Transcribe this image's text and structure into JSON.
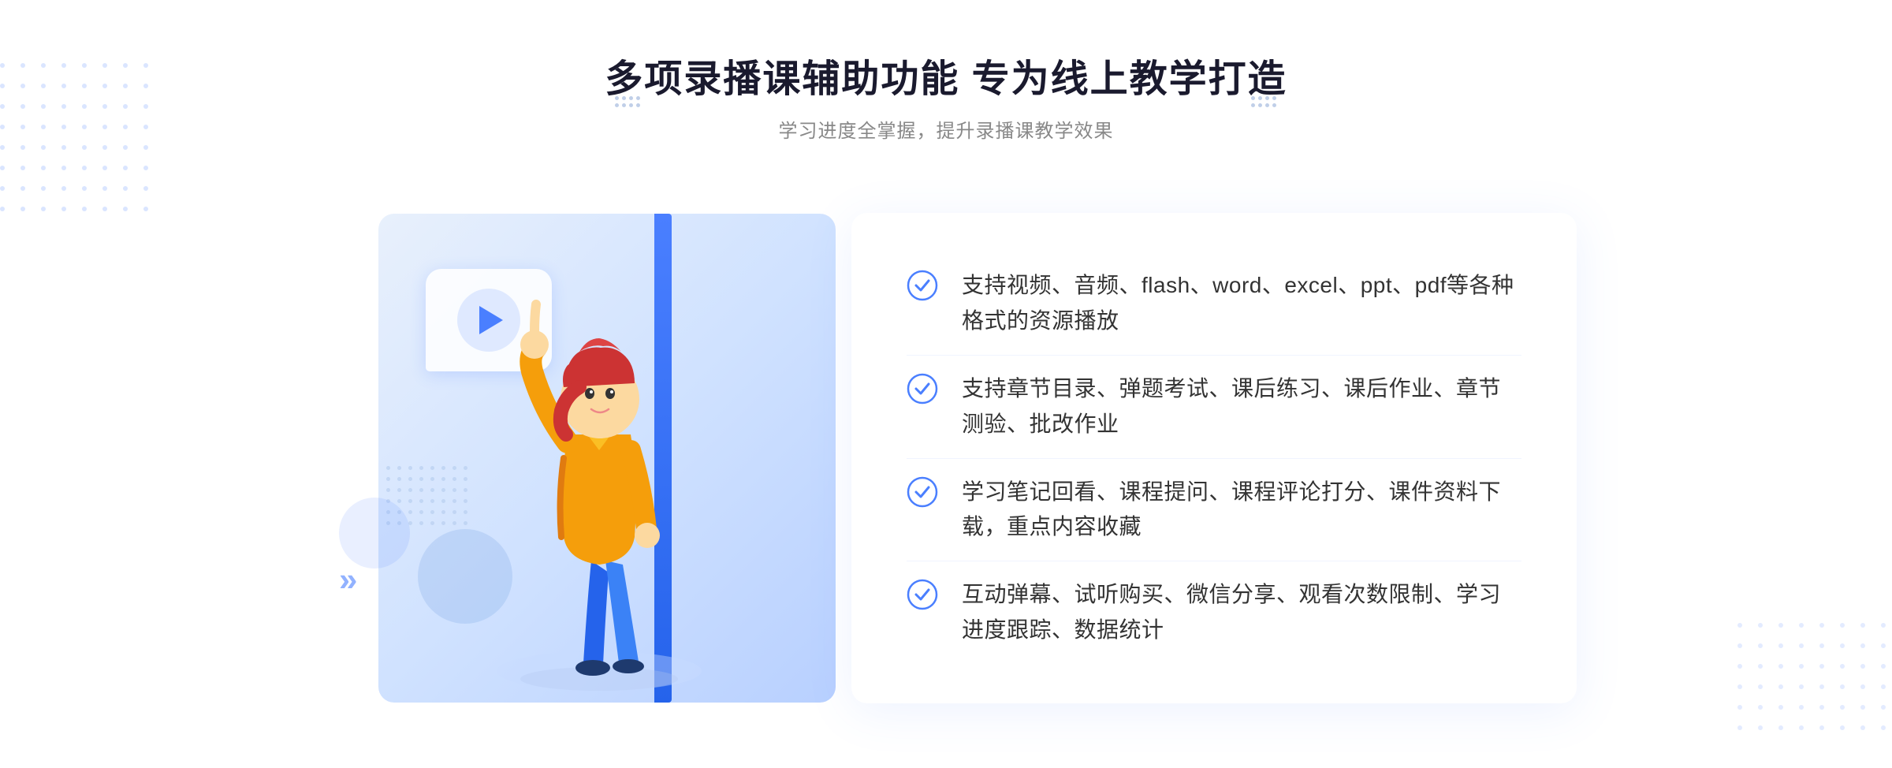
{
  "header": {
    "title": "多项录播课辅助功能 专为线上教学打造",
    "subtitle": "学习进度全掌握，提升录播课教学效果"
  },
  "features": [
    {
      "id": 1,
      "text": "支持视频、音频、flash、word、excel、ppt、pdf等各种格式的资源播放"
    },
    {
      "id": 2,
      "text": "支持章节目录、弹题考试、课后练习、课后作业、章节测验、批改作业"
    },
    {
      "id": 3,
      "text": "学习笔记回看、课程提问、课程评论打分、课件资料下载，重点内容收藏"
    },
    {
      "id": 4,
      "text": "互动弹幕、试听购买、微信分享、观看次数限制、学习进度跟踪、数据统计"
    }
  ],
  "colors": {
    "accent": "#4a7fff",
    "title": "#1a1a2e",
    "text": "#333333",
    "subtitle": "#888888",
    "check": "#4a7fff"
  },
  "decorations": {
    "dotsLeft": "⋮⋮",
    "dotsRight": "⋮⋮",
    "arrowLeft": "»"
  }
}
